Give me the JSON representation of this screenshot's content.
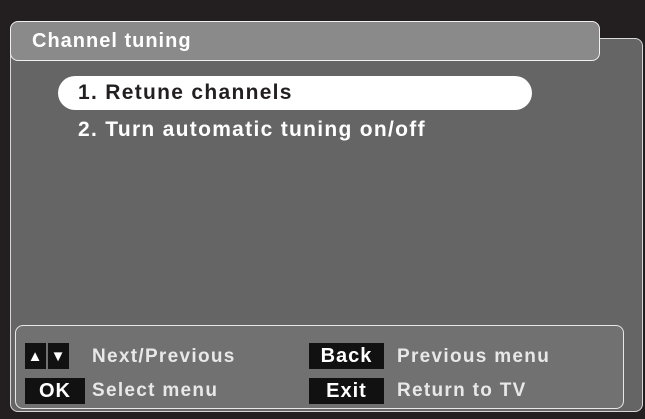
{
  "screen": {
    "title": "Channel tuning",
    "menu": [
      {
        "label": "1. Retune channels",
        "selected": true
      },
      {
        "label": "2. Turn automatic tuning on/off",
        "selected": false
      }
    ]
  },
  "footer": {
    "up_key": "▲",
    "down_key": "▼",
    "next_previous": "Next/Previous",
    "back_key": "Back",
    "previous_menu": "Previous menu",
    "ok_key": "OK",
    "select_menu": "Select menu",
    "exit_key": "Exit",
    "return_to_tv": "Return to TV"
  },
  "colors": {
    "background": "#231f20",
    "panel": "#656565",
    "title_bar": "#8a8a8a",
    "highlight": "#ffffff",
    "key_fill": "#111111"
  }
}
